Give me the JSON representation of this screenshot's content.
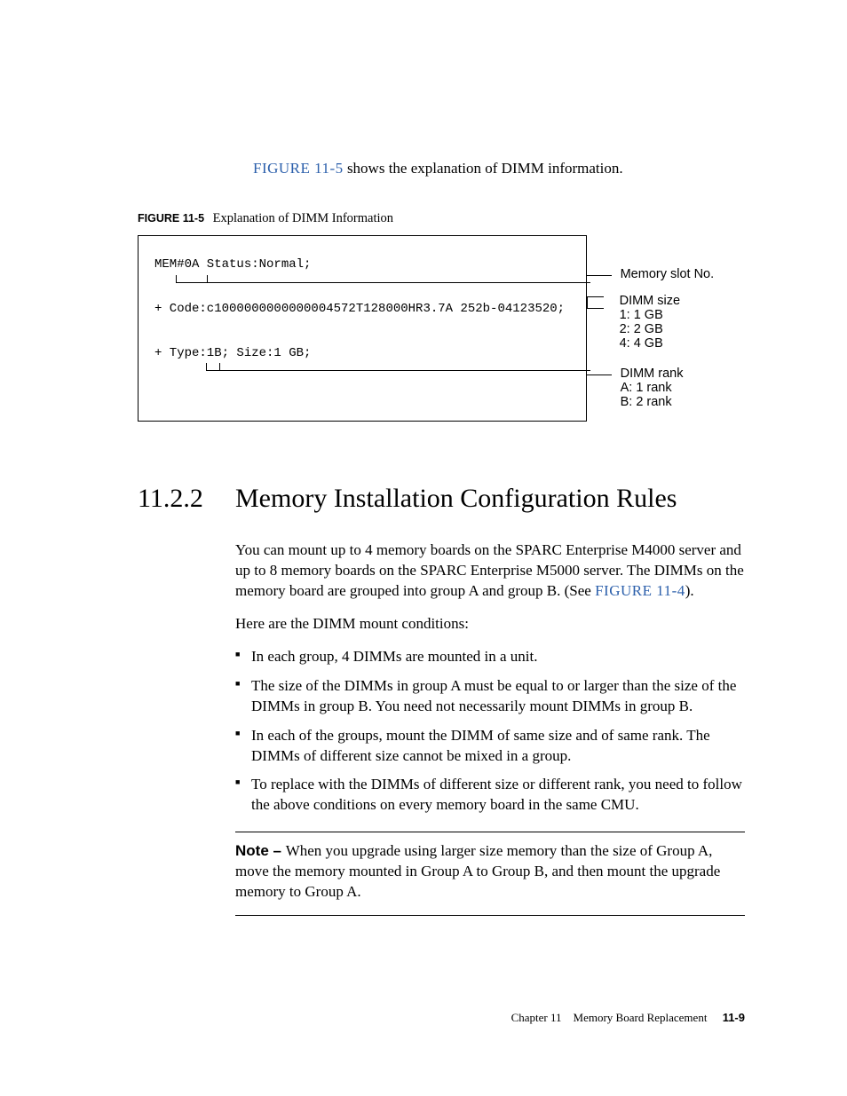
{
  "intro": {
    "link_text": "FIGURE 11-5",
    "rest": " shows the explanation of DIMM information."
  },
  "figure": {
    "label": "FIGURE 11-5",
    "caption": "Explanation of DIMM Information",
    "code": {
      "line1": "MEM#0A Status:Normal;",
      "line2": "+ Code:c1000000000000004572T128000HR3.7A 252b-04123520;",
      "line3": "+ Type:1B; Size:1 GB;"
    },
    "callouts": {
      "slot": "Memory slot No.",
      "size_title": "DIMM size",
      "size_1": "1: 1 GB",
      "size_2": "2: 2 GB",
      "size_4": "4: 4 GB",
      "rank_title": "DIMM rank",
      "rank_a": "A: 1 rank",
      "rank_b": "B: 2 rank"
    }
  },
  "section": {
    "number": "11.2.2",
    "title": "Memory Installation Configuration Rules",
    "para1_a": "You can mount up to 4 memory boards on the SPARC Enterprise M4000 server and up to 8 memory boards on the SPARC Enterprise M5000 server. The DIMMs on the memory board are grouped into group A and group B. (See ",
    "para1_link": "FIGURE 11-4",
    "para1_b": ").",
    "para2": "Here are the DIMM mount conditions:",
    "bullets": [
      "In each group, 4 DIMMs are mounted in a unit.",
      "The size of the DIMMs in group A must be equal to or larger than the size of the DIMMs in group B. You need not necessarily mount DIMMs in group B.",
      "In each of the groups, mount the DIMM of same size and of same rank. The DIMMs of different size cannot be mixed in a group.",
      "To replace with the DIMMs of different size or different rank, you need to follow the above conditions on every memory board in the same CMU."
    ],
    "note_label": "Note – ",
    "note_body": "When you upgrade using larger size memory than the size of Group A, move the memory mounted in Group A to Group B, and then mount the upgrade memory to Group A."
  },
  "footer": {
    "chapter": "Chapter 11",
    "title": "Memory Board Replacement",
    "page": "11-9"
  }
}
